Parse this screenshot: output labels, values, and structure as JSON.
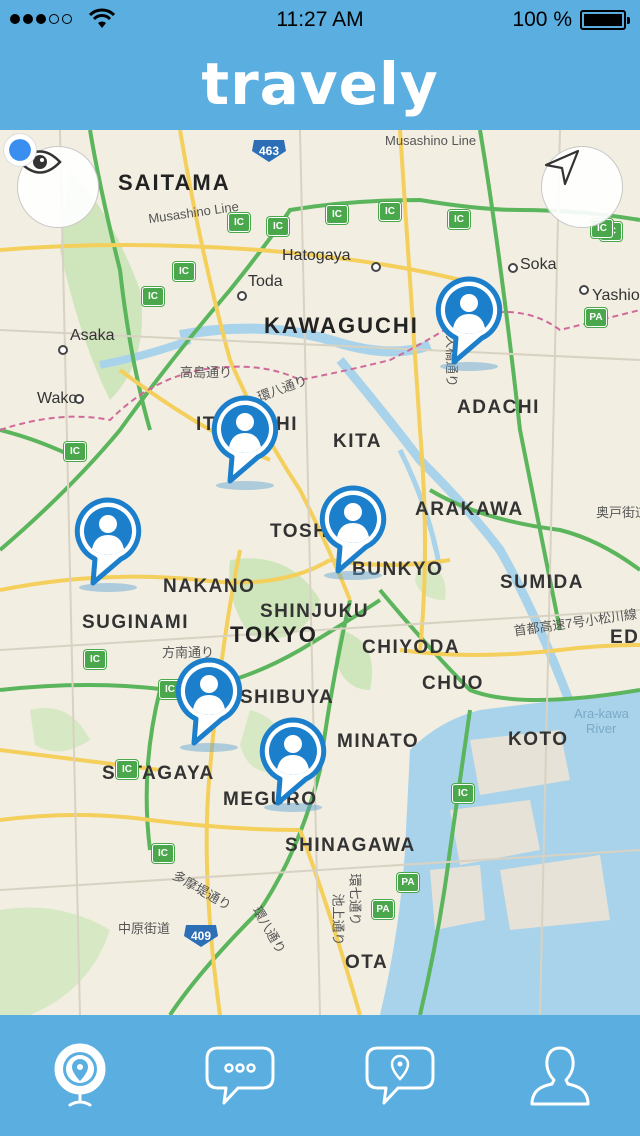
{
  "status": {
    "time": "11:27 AM",
    "battery": "100 %"
  },
  "header": {
    "title": "travely"
  },
  "map": {
    "labels": {
      "saitama": "SAITAMA",
      "musashino_line_top": "Musashino Line",
      "musashino_line_left": "Musashino Line",
      "hatogaya": "Hatogaya",
      "toda": "Toda",
      "kawaguchi": "KAWAGUCHI",
      "asaka": "Asaka",
      "wako": "Wako",
      "soka": "Soka",
      "yashio": "Yashio",
      "adachi": "ADACHI",
      "kita": "KITA",
      "itabashi_part": "IT",
      "itabashi_part2": "HI",
      "toshima_part": "TOSH",
      "arakawa": "ARAKAWA",
      "bunkyo": "BUNKYO",
      "nakano": "NAKANO",
      "sumida": "SUMIDA",
      "suginami": "SUGINAMI",
      "shinjuku": "SHINJUKU",
      "tokyo": "TOKYO",
      "chiyoda": "CHIYODA",
      "chuo": "CHUO",
      "edogawa_part": "ED",
      "shibuya": "SHIBUYA",
      "minato": "MINATO",
      "koto": "KOTO",
      "arakawa_river_line1": "Ara-kawa",
      "arakawa_river_line2": "River",
      "setagaya": "SETAGAYA",
      "meguro": "MEGURO",
      "shinagawa": "SHINAGAWA",
      "ota": "OTA",
      "route_463": "463",
      "route_409": "409",
      "jp_takashima": "高島通り",
      "jp_kannana": "環八通り",
      "jp_hoyo": "方南通り",
      "jp_tamazutsumi": "多摩堤通り",
      "jp_nakahara": "中原街道",
      "jp_kanpachi2": "環八通り",
      "jp_okukaido": "奥戸街道",
      "jp_shuto": "首都高速7号小松川線",
      "jp_odai": "尾久橋通り",
      "jp_kan7": "環七通り",
      "jp_ikegami": "池上通り",
      "ic": "IC",
      "pa": "PA"
    }
  },
  "controls": {
    "visibility_icon": "eye-icon",
    "locate_icon": "navigation-arrow-icon"
  },
  "tabs": [
    {
      "name": "webcam-icon",
      "selected": true
    },
    {
      "name": "chat-bubble-icon",
      "selected": false
    },
    {
      "name": "location-bubble-icon",
      "selected": false
    },
    {
      "name": "profile-icon",
      "selected": false
    }
  ],
  "colors": {
    "brand": "#5aaee0",
    "pin": "#1b7fcb",
    "water": "#a9d3ea"
  }
}
